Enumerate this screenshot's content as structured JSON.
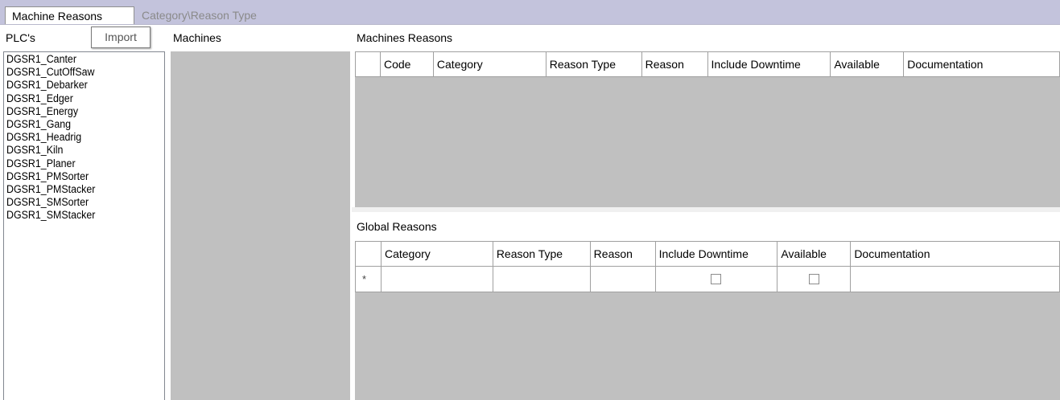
{
  "tabs": [
    {
      "label": "Machine Reasons",
      "active": true
    },
    {
      "label": "Category\\Reason Type",
      "active": false
    }
  ],
  "plc": {
    "label": "PLC's",
    "import_label": "Import",
    "items": [
      "DGSR1_Canter",
      "DGSR1_CutOffSaw",
      "DGSR1_Debarker",
      "DGSR1_Edger",
      "DGSR1_Energy",
      "DGSR1_Gang",
      "DGSR1_Headrig",
      "DGSR1_Kiln",
      "DGSR1_Planer",
      "DGSR1_PMSorter",
      "DGSR1_PMStacker",
      "DGSR1_SMSorter",
      "DGSR1_SMStacker"
    ]
  },
  "machines": {
    "label": "Machines"
  },
  "machine_reasons": {
    "label": "Machines Reasons",
    "columns": [
      "Code",
      "Category",
      "Reason Type",
      "Reason",
      "Include Downtime",
      "Available",
      "Documentation"
    ]
  },
  "global_reasons": {
    "label": "Global Reasons",
    "columns": [
      "Category",
      "Reason Type",
      "Reason",
      "Include Downtime",
      "Available",
      "Documentation"
    ],
    "new_row_marker": "*",
    "new_row": {
      "include_downtime": false,
      "available": false
    }
  },
  "colors": {
    "tabstrip": "#c3c3dc",
    "grid_background": "#c0c0c0"
  }
}
